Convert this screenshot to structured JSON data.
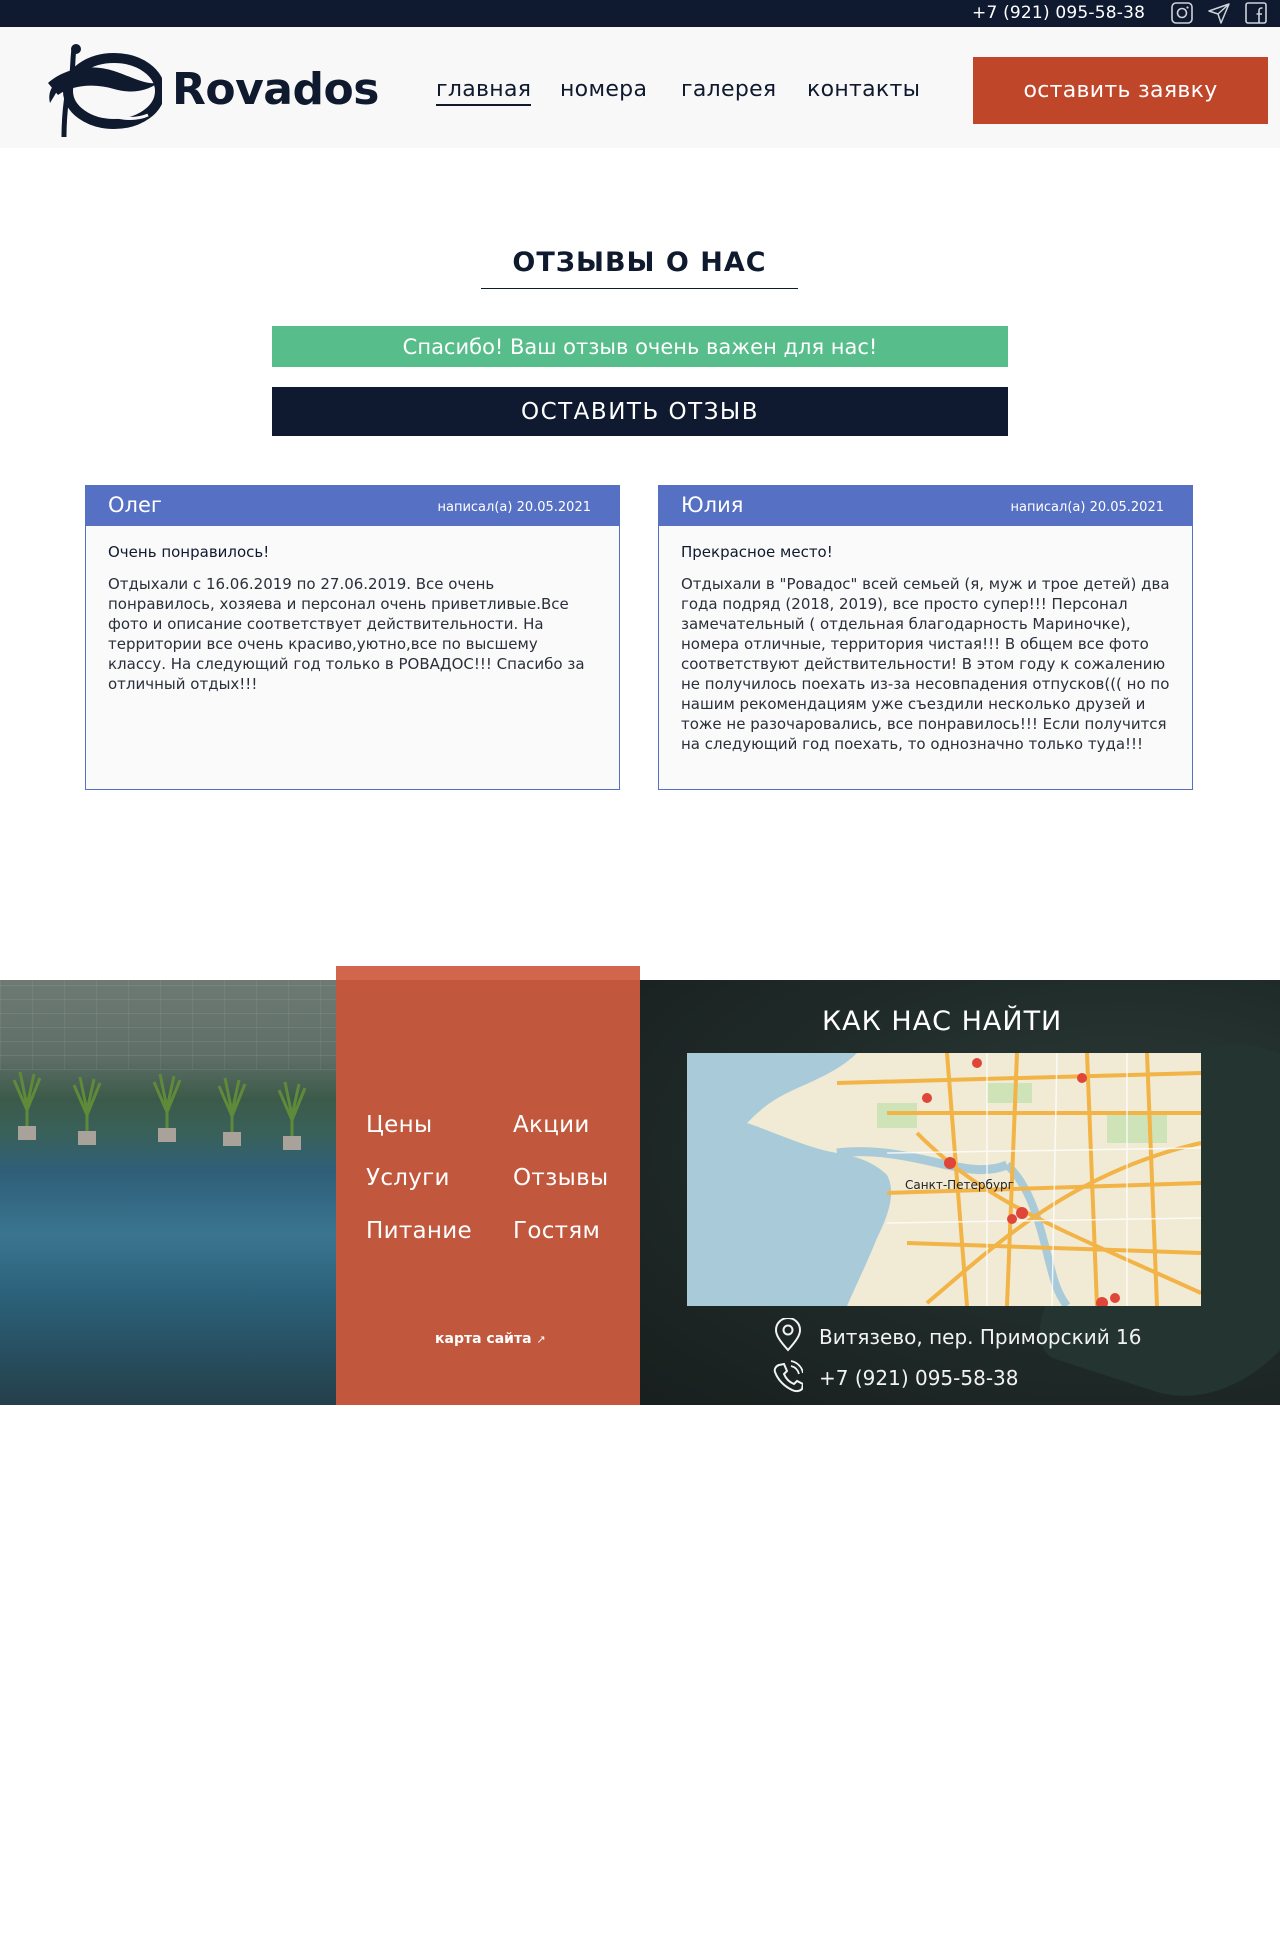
{
  "topbar": {
    "phone": "+7 (921) 095-58-38",
    "icons": [
      "instagram-icon",
      "telegram-icon",
      "facebook-icon"
    ]
  },
  "header": {
    "brand": "Rovados",
    "nav": [
      {
        "label": "главная",
        "active": true
      },
      {
        "label": "номера",
        "active": false
      },
      {
        "label": "галерея",
        "active": false
      },
      {
        "label": "контакты",
        "active": false
      }
    ],
    "cta_label": "оставить заявку"
  },
  "reviews": {
    "title": "ОТЗЫВЫ О НАС",
    "success_message": "Спасибо! Ваш отзыв очень важен для нас!",
    "leave_button": "ОСТАВИТЬ ОТЗЫВ",
    "items": [
      {
        "name": "Олег",
        "date": "написал(а) 20.05.2021",
        "subject": "Очень понравилось!",
        "text": "Отдыхали с 16.06.2019 по 27.06.2019. Все очень понравилось, хозяева и персонал очень приветливые.Все фото и описание соответствует действительности. На территории все очень красиво,уютно,все по высшему классу. На следующий год только в РОВАДОС!!! Спасибо за отличный отдых!!!"
      },
      {
        "name": "Юлия",
        "date": "написал(а) 20.05.2021",
        "subject": "Прекрасное место!",
        "text": "Отдыхали в \"Ровадос\" всей семьей (я, муж и трое детей) два года подряд (2018, 2019), все просто супер!!! Персонал замечательный ( отдельная благодарноcть Мариночке), номера отличные, территория чистая!!! В общем все фото соответствуют действительности! В этом году к сожалению не получилось поехать из-за несовпадения отпусков((( но по нашим рекомендациям уже съездили несколько друзей и тоже не разочаровались, все понравилось!!! Если получится на следующий год поехать, то однозначно только туда!!!"
      }
    ]
  },
  "footer": {
    "links": [
      "Цены",
      "Акции",
      "Услуги",
      "Отзывы",
      "Питание",
      "Гостям"
    ],
    "sitemap_label": "карта сайта",
    "find_title": "КАК НАС НАЙТИ",
    "map_city_label": "Санкт-Петербург",
    "address": "Витязево, пер. Приморский 16",
    "phone": "+7 (921) 095-58-38"
  },
  "colors": {
    "navy": "#0f1a30",
    "accent": "#c0462a",
    "success": "#57bd8a",
    "card_header": "#5670c4"
  }
}
